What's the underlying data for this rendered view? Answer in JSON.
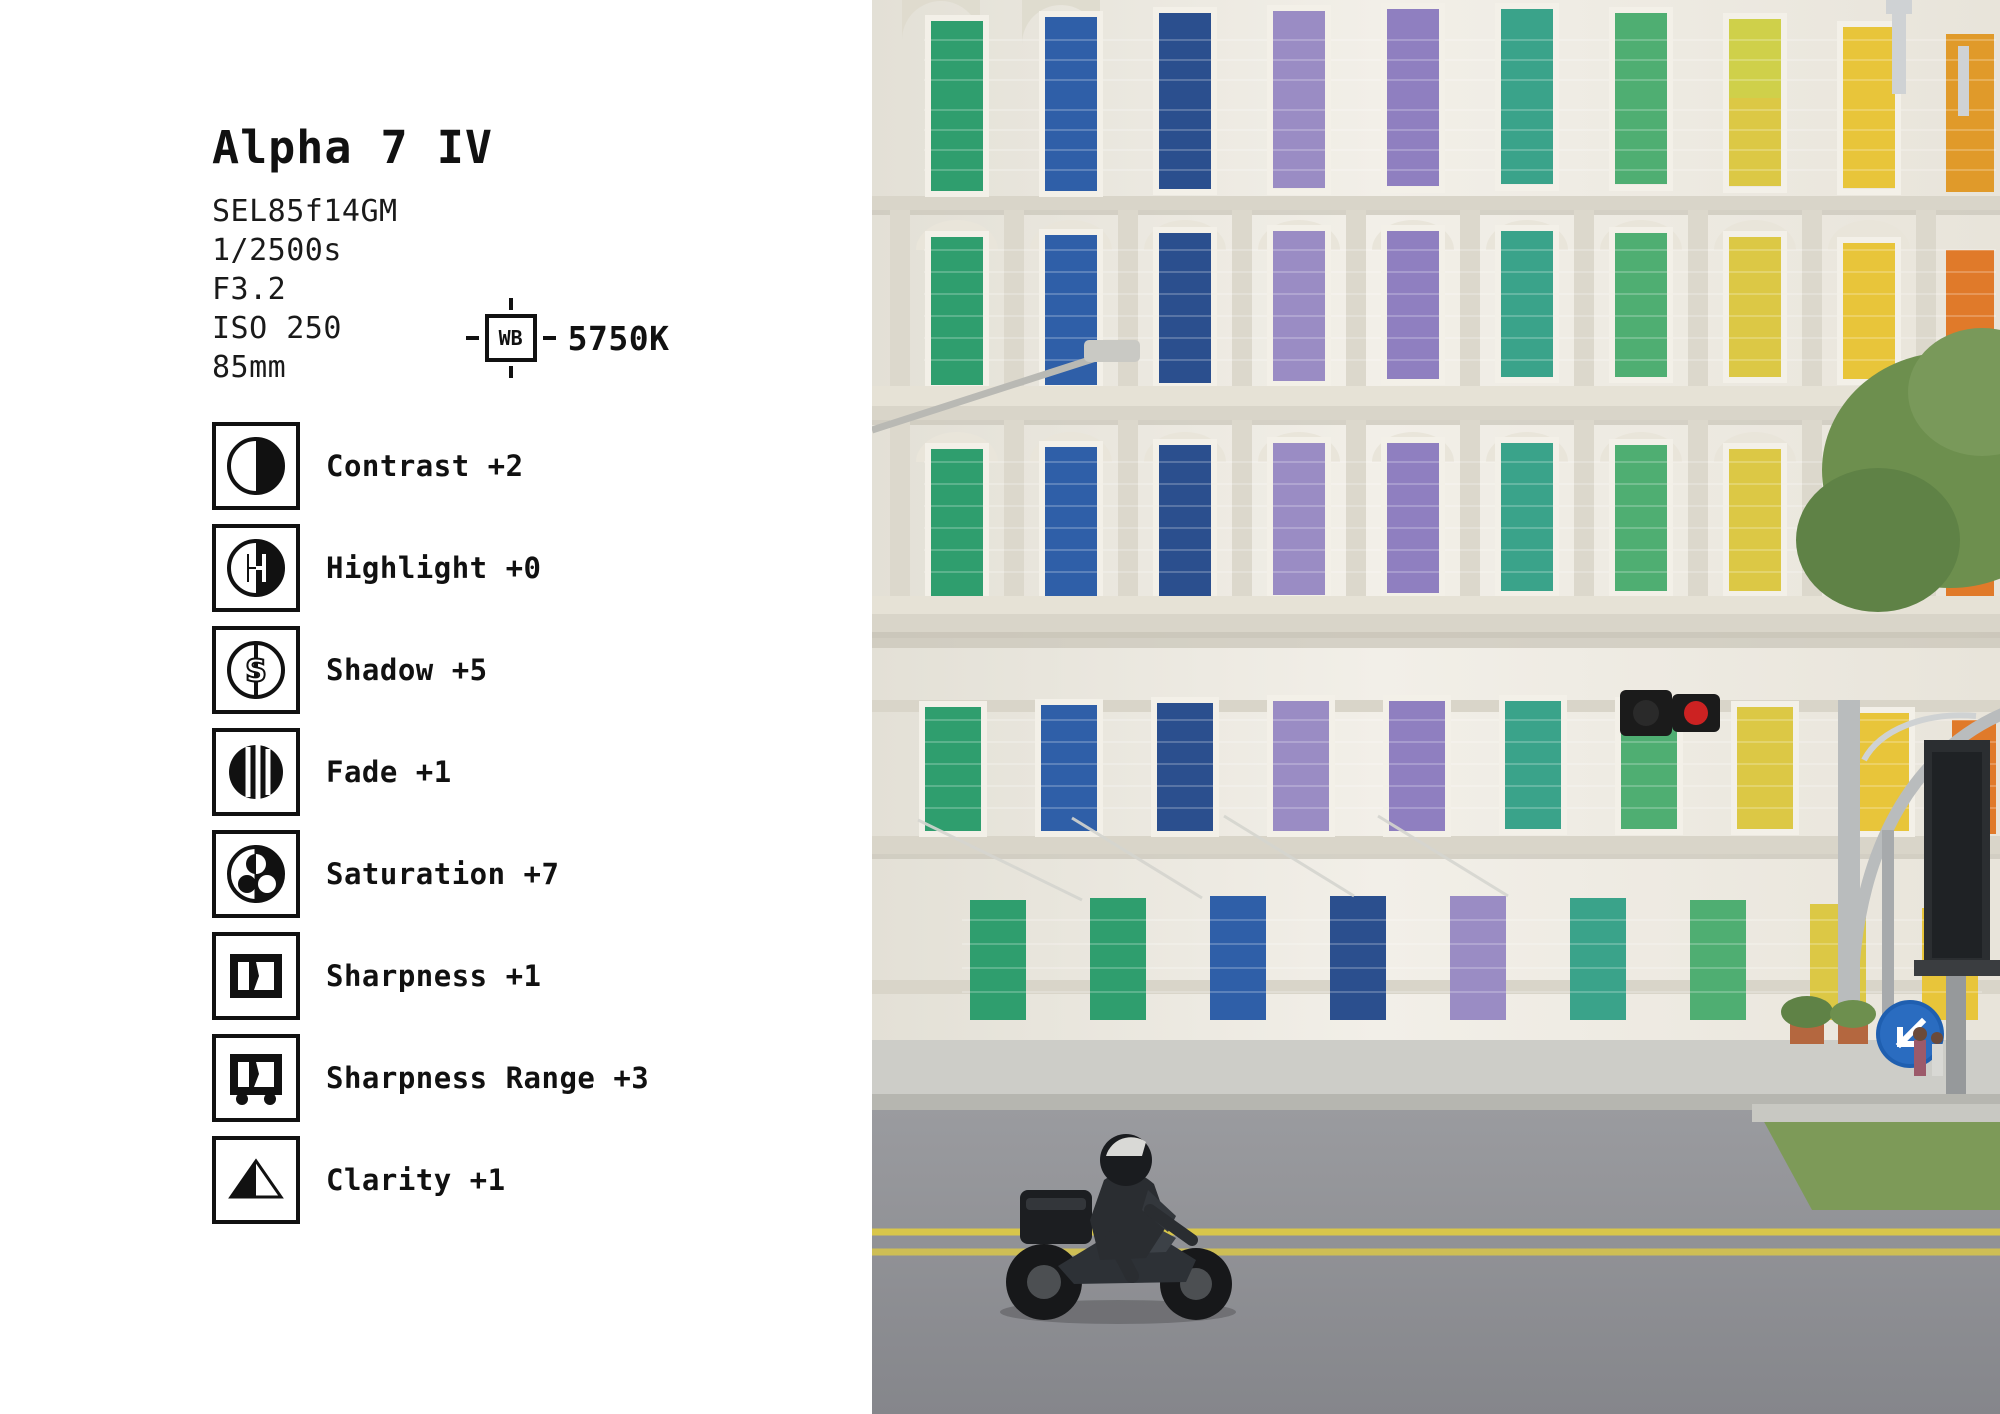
{
  "panel": {
    "camera_title": "Alpha 7 IV",
    "exif": [
      "SEL85f14GM",
      "1/2500s",
      "F3.2",
      "ISO 250",
      "85mm"
    ],
    "white_balance": {
      "badge_label": "WB",
      "temperature": "5750K"
    },
    "adjustments": [
      {
        "icon": "contrast-icon",
        "label": "Contrast +2"
      },
      {
        "icon": "highlight-icon",
        "label": "Highlight +0"
      },
      {
        "icon": "shadow-icon",
        "label": "Shadow +5"
      },
      {
        "icon": "fade-icon",
        "label": "Fade +1"
      },
      {
        "icon": "saturation-icon",
        "label": "Saturation +7"
      },
      {
        "icon": "sharpness-icon",
        "label": "Sharpness +1"
      },
      {
        "icon": "sharpness-range-icon",
        "label": "Sharpness Range +3"
      },
      {
        "icon": "clarity-icon",
        "label": "Clarity +1"
      }
    ]
  },
  "photo": {
    "alt": "Colonial building facade with rainbow-coloured louvered shutters, motorcycle on street",
    "colors": {
      "facade": "#efece4",
      "facade_shadow": "#d8d4c9",
      "sky": "#fbfbfa",
      "road": "#8f9094",
      "road_line": "#d9c64a",
      "grass": "#7d9a58",
      "tree": "#6d8f4e",
      "shutter_green": "#2f9e6e",
      "shutter_blue": "#2f5fa8",
      "shutter_navy": "#2b4f8e",
      "shutter_purple": "#9a8cc4",
      "shutter_teal": "#3aa38a",
      "shutter_yellow": "#e8c53a",
      "shutter_orange": "#e07a2a",
      "shutter_red": "#c8432c",
      "traffic_light": "#1b1b1b",
      "traffic_red": "#cc2222",
      "sign_blue": "#1f5fb0"
    }
  }
}
